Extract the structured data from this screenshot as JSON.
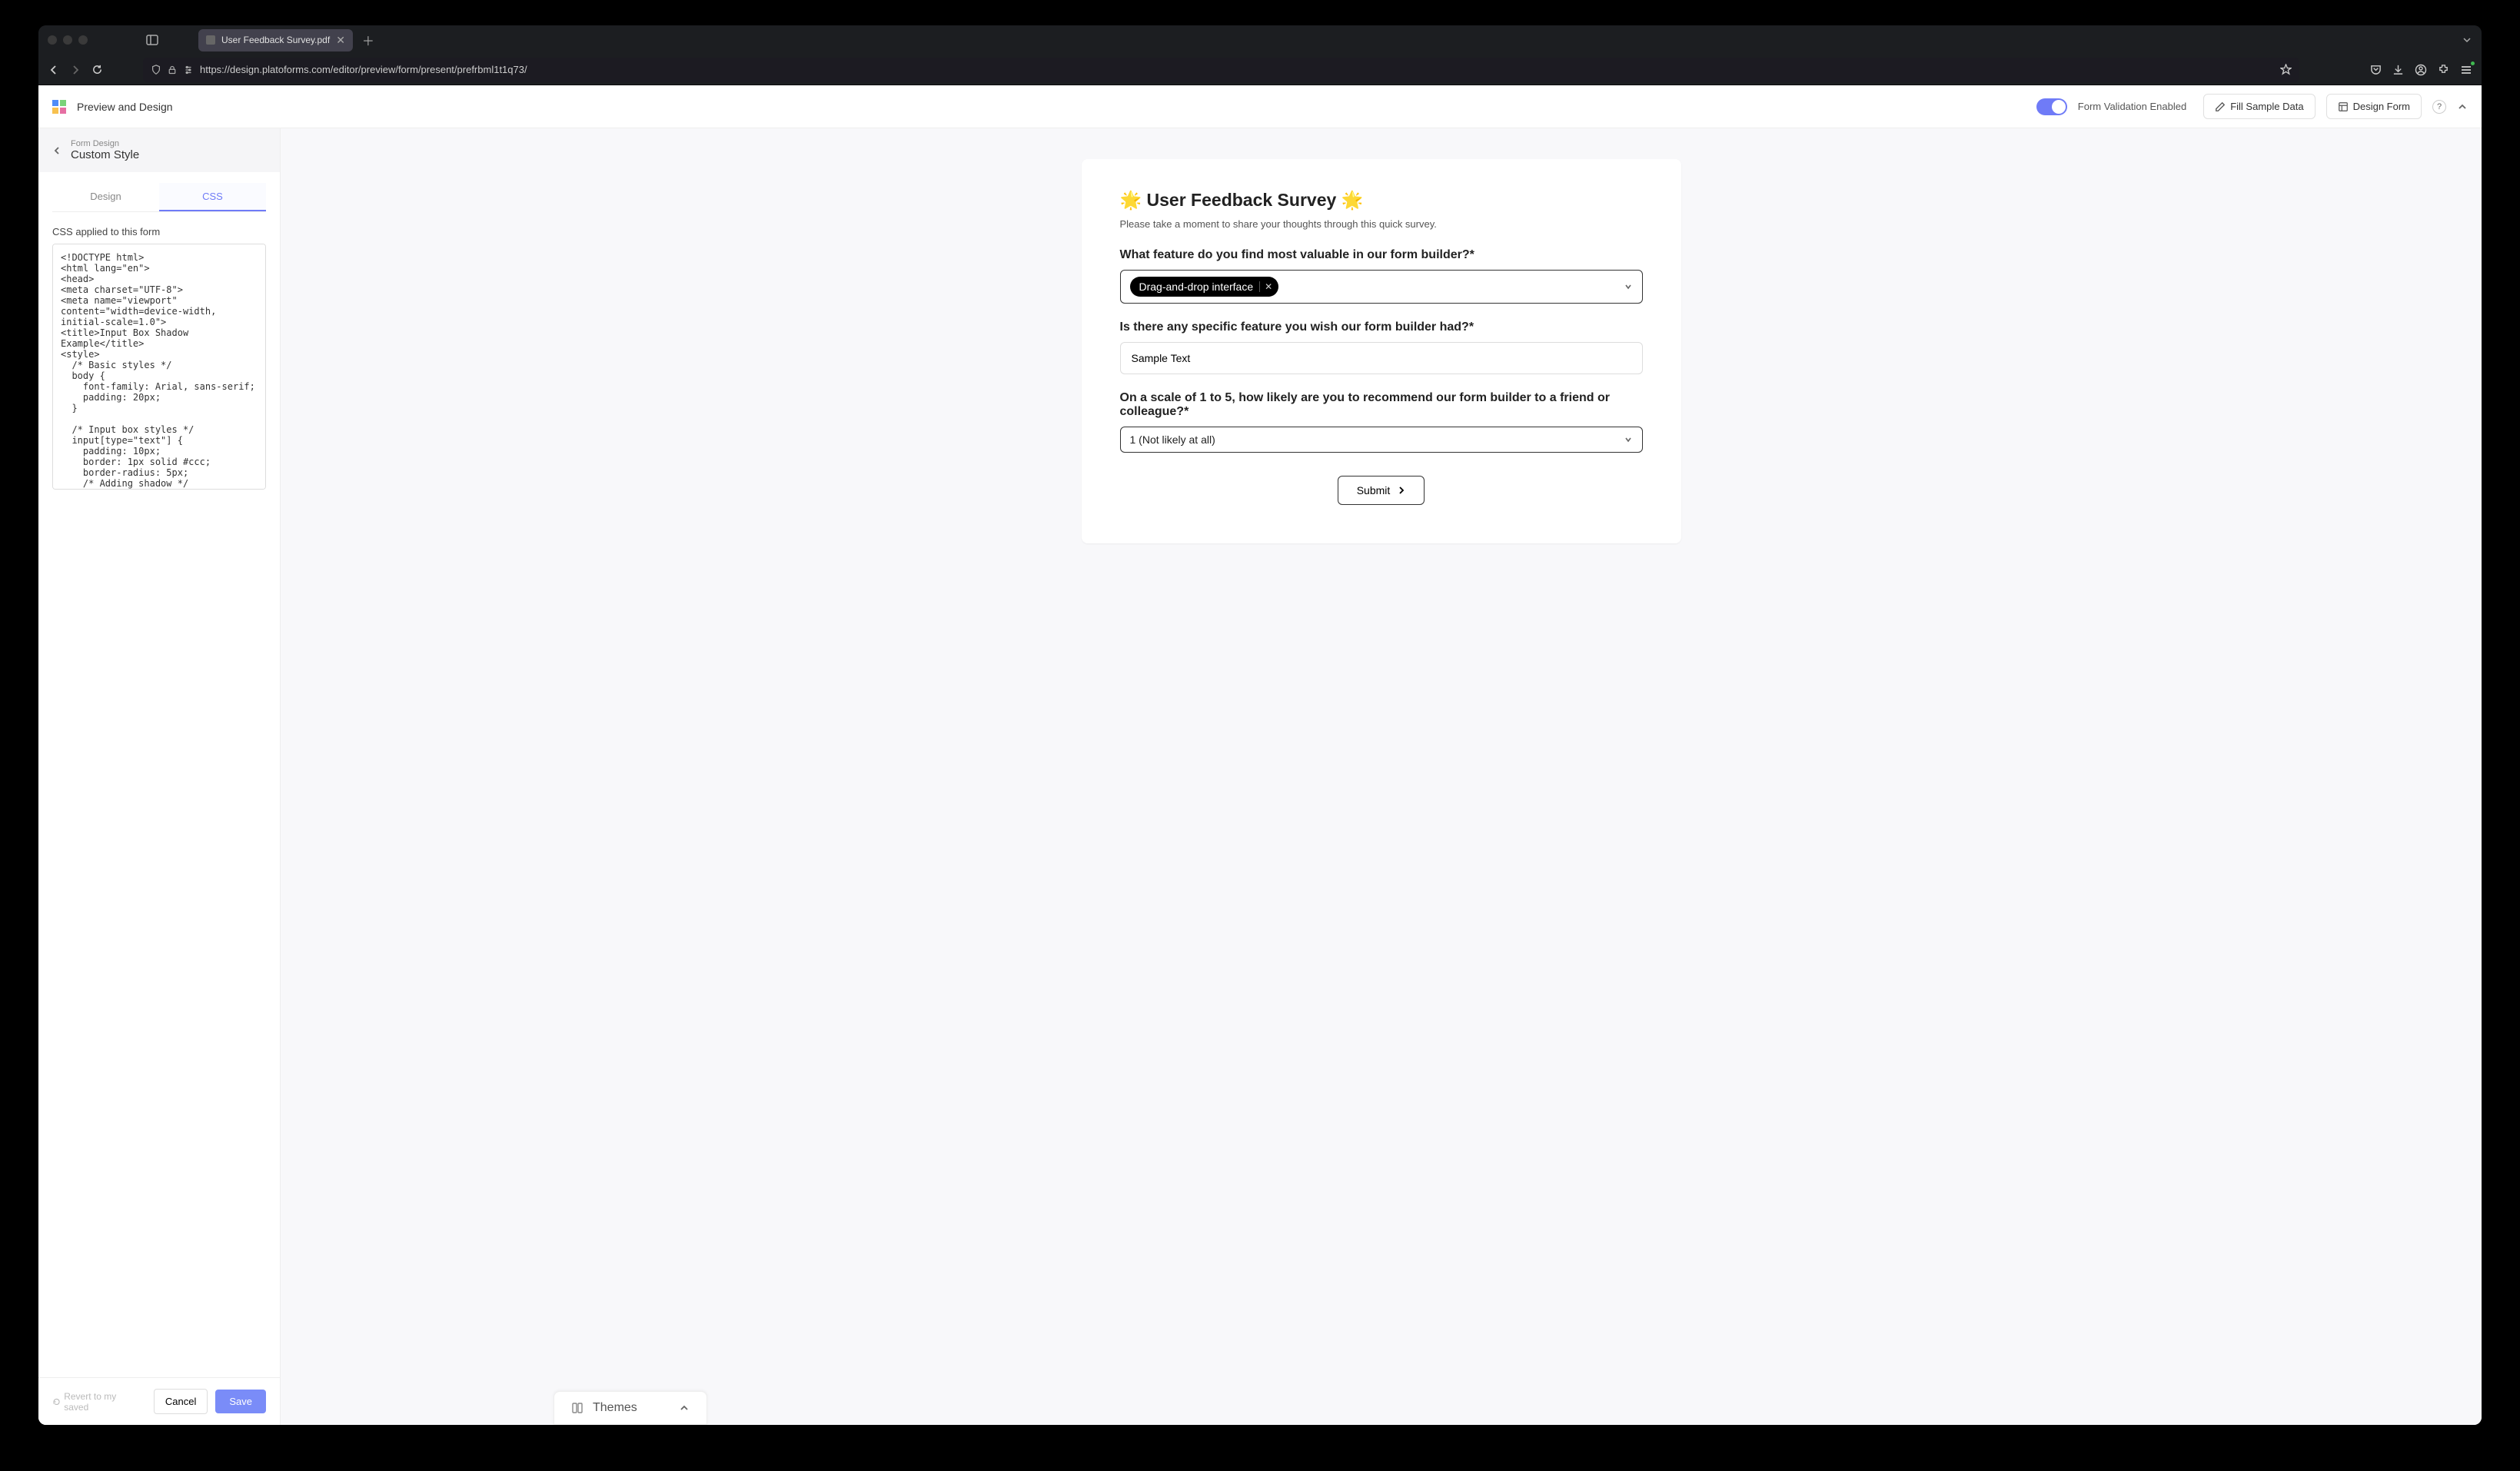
{
  "browser": {
    "tab_title": "User Feedback Survey.pdf",
    "url": "https://design.platoforms.com/editor/preview/form/present/prefrbml1t1q73/"
  },
  "header": {
    "title": "Preview and Design",
    "toggle_label": "Form Validation Enabled",
    "fill_sample": "Fill Sample Data",
    "design_form": "Design Form"
  },
  "panel": {
    "breadcrumb": "Form Design",
    "title": "Custom Style",
    "tabs": {
      "design": "Design",
      "css": "CSS"
    },
    "css_label": "CSS applied to this form",
    "css_code": "<!DOCTYPE html>\n<html lang=\"en\">\n<head>\n<meta charset=\"UTF-8\">\n<meta name=\"viewport\" content=\"width=device-width, initial-scale=1.0\">\n<title>Input Box Shadow Example</title>\n<style>\n  /* Basic styles */\n  body {\n    font-family: Arial, sans-serif;\n    padding: 20px;\n  }\n\n  /* Input box styles */\n  input[type=\"text\"] {\n    padding: 10px;\n    border: 1px solid #ccc;\n    border-radius: 5px;\n    /* Adding shadow */",
    "revert": "Revert to my saved",
    "cancel": "Cancel",
    "save": "Save"
  },
  "form": {
    "title": "🌟 User Feedback Survey 🌟",
    "subtitle": "Please take a moment to share your thoughts through this quick survey.",
    "q1": "What feature do you find most valuable in our form builder?*",
    "q1_chip": "Drag-and-drop interface",
    "q2": "Is there any specific feature you wish our form builder had?*",
    "q2_value": "Sample Text",
    "q3": "On a scale of 1 to 5, how likely are you to recommend our form builder to a friend or colleague?*",
    "q3_value": "1 (Not likely at all)",
    "submit": "Submit"
  },
  "themes": {
    "label": "Themes"
  }
}
